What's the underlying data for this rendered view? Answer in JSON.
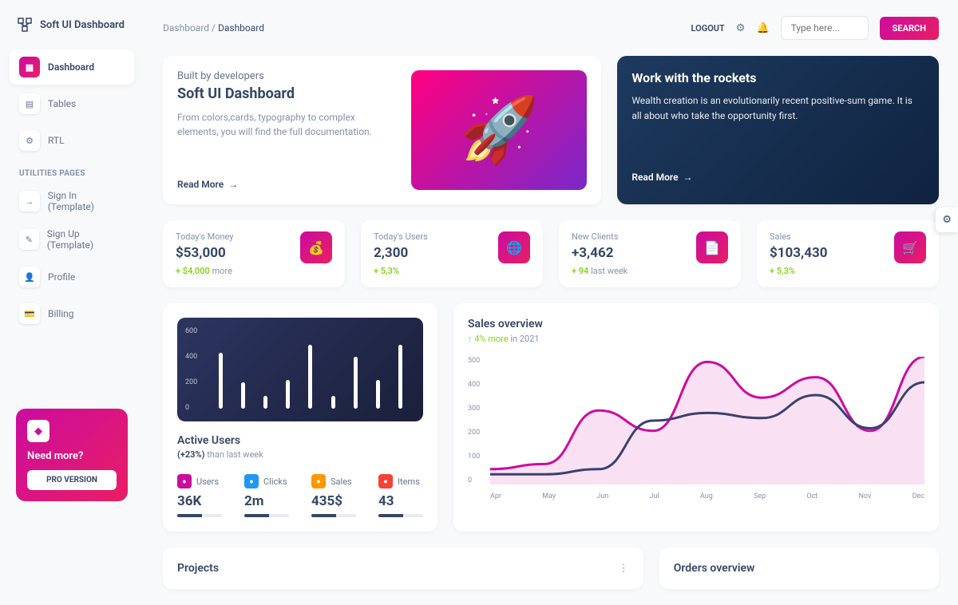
{
  "brand": "Soft UI Dashboard",
  "breadcrumb": {
    "parent": "Dashboard",
    "current": "Dashboard"
  },
  "topbar": {
    "logout": "LOGOUT",
    "search_placeholder": "Type here...",
    "search_btn": "SEARCH"
  },
  "sidebar": {
    "items": [
      {
        "label": "Dashboard"
      },
      {
        "label": "Tables"
      },
      {
        "label": "RTL"
      }
    ],
    "section": "UTILITIES PAGES",
    "util_items": [
      {
        "label": "Sign In (Template)"
      },
      {
        "label": "Sign Up (Template)"
      },
      {
        "label": "Profile"
      },
      {
        "label": "Billing"
      }
    ]
  },
  "promo": {
    "title": "Need more?",
    "btn": "PRO VERSION"
  },
  "hero": {
    "sub": "Built by developers",
    "title": "Soft UI Dashboard",
    "desc": "From colors,cards, typography to complex elements, you will find the full documentation.",
    "read_more": "Read More"
  },
  "rockets": {
    "title": "Work with the rockets",
    "desc": "Wealth creation is an evolutionarily recent positive-sum game. It is all about who take the opportunity first.",
    "read_more": "Read More"
  },
  "stats": [
    {
      "label": "Today's Money",
      "value": "$53,000",
      "change": "+ $4,000",
      "suffix": " more"
    },
    {
      "label": "Today's Users",
      "value": "2,300",
      "change": "+ 5,3%",
      "suffix": ""
    },
    {
      "label": "New Clients",
      "value": "+3,462",
      "change": "+ 94",
      "suffix": " last week"
    },
    {
      "label": "Sales",
      "value": "$103,430",
      "change": "+ 5,3%",
      "suffix": ""
    }
  ],
  "active_users": {
    "title": "Active Users",
    "sub_bold": "(+23%)",
    "sub_rest": " than last week",
    "metrics": [
      {
        "label": "Users",
        "value": "36K",
        "color": "#cb0c9f"
      },
      {
        "label": "Clicks",
        "value": "2m",
        "color": "#2196f3"
      },
      {
        "label": "Sales",
        "value": "435$",
        "color": "#ff9800"
      },
      {
        "label": "Items",
        "value": "43",
        "color": "#f44336"
      }
    ]
  },
  "sales_overview": {
    "title": "Sales overview",
    "sub_change": "4% more",
    "sub_rest": " in 2021"
  },
  "projects": {
    "title": "Projects"
  },
  "orders": {
    "title": "Orders overview"
  },
  "chart_data": [
    {
      "type": "bar",
      "ylim": [
        0,
        600
      ],
      "yticks": [
        0,
        200,
        400,
        600
      ],
      "values": [
        430,
        200,
        100,
        220,
        490,
        100,
        400,
        220,
        490
      ]
    },
    {
      "type": "line",
      "ylim": [
        0,
        500
      ],
      "yticks": [
        0,
        100,
        200,
        300,
        400,
        500
      ],
      "categories": [
        "Apr",
        "May",
        "Jun",
        "Jul",
        "Aug",
        "Sep",
        "Oct",
        "Nov",
        "Dec"
      ],
      "series": [
        {
          "name": "pink",
          "color": "#cb0c9f",
          "values": [
            60,
            80,
            290,
            210,
            480,
            340,
            420,
            210,
            500
          ]
        },
        {
          "name": "navy",
          "color": "#3a416f",
          "values": [
            40,
            40,
            60,
            250,
            280,
            260,
            350,
            220,
            400
          ]
        }
      ]
    }
  ]
}
